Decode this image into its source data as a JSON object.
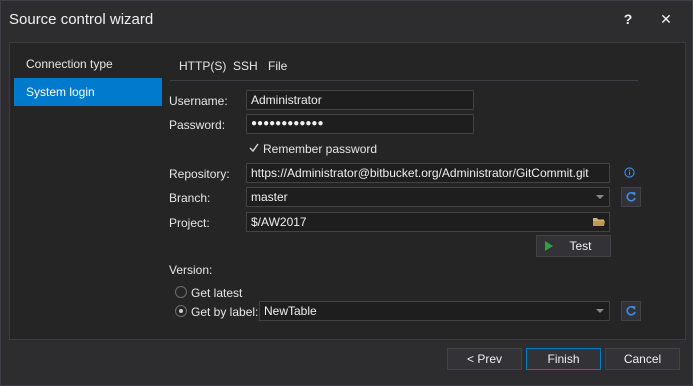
{
  "window": {
    "title": "Source control wizard",
    "help_label": "?",
    "close_label": "✕"
  },
  "nav": {
    "items": [
      {
        "label": "Connection type",
        "active": false
      },
      {
        "label": "System login",
        "active": true
      }
    ]
  },
  "tabs": [
    {
      "label": "HTTP(S)",
      "active": true
    },
    {
      "label": "SSH",
      "active": false
    },
    {
      "label": "File",
      "active": false
    }
  ],
  "form": {
    "username_label": "Username:",
    "username_value": "Administrator",
    "password_label": "Password:",
    "password_value": "●●●●●●●●●●●●",
    "remember_label": "Remember password",
    "remember_checked": true,
    "repository_label": "Repository:",
    "repository_value": "https://Administrator@bitbucket.org/Administrator/GitCommit.git",
    "branch_label": "Branch:",
    "branch_value": "master",
    "project_label": "Project:",
    "project_value": "$/AW2017",
    "test_label": "Test",
    "version_label": "Version:",
    "get_latest_label": "Get latest",
    "get_by_label_label": "Get by label:",
    "label_value": "NewTable",
    "selected_version": "get_by_label"
  },
  "footer": {
    "prev_label": "< Prev",
    "finish_label": "Finish",
    "cancel_label": "Cancel"
  },
  "colors": {
    "accent": "#007acc",
    "info_icon": "#3d8ee6",
    "refresh_icon": "#3d8ee6",
    "play_icon": "#2ea043",
    "folder_icon": "#d7b46a"
  }
}
